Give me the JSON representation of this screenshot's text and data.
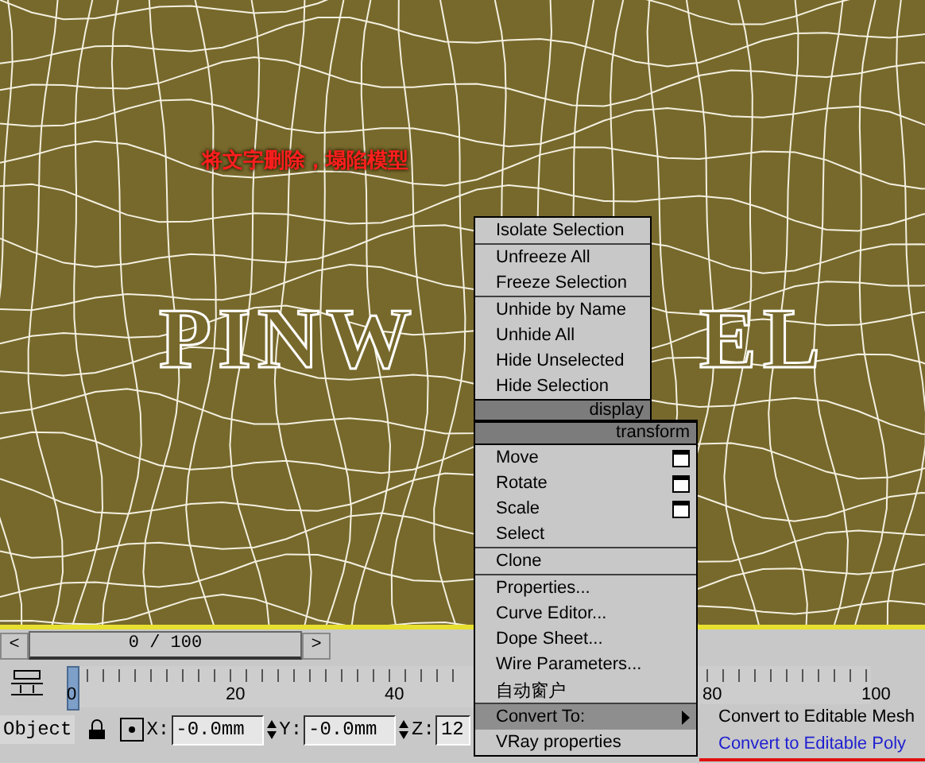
{
  "viewport": {
    "annotation": "将文字删除，塌陷模型",
    "text_object": [
      "PINW",
      "EL"
    ]
  },
  "quad_menu": {
    "display": {
      "title": "display",
      "groups": [
        [
          {
            "label": "Isolate Selection",
            "has_options": false,
            "selected": false
          }
        ],
        [
          {
            "label": "Unfreeze All",
            "has_options": false,
            "selected": false
          },
          {
            "label": "Freeze Selection",
            "has_options": false,
            "selected": false
          }
        ],
        [
          {
            "label": "Unhide by Name",
            "has_options": false,
            "selected": false
          },
          {
            "label": "Unhide All",
            "has_options": false,
            "selected": false
          },
          {
            "label": "Hide Unselected",
            "has_options": false,
            "selected": false
          },
          {
            "label": "Hide Selection",
            "has_options": false,
            "selected": false
          }
        ]
      ]
    },
    "transform": {
      "title": "transform",
      "groups": [
        [
          {
            "label": "Move",
            "has_options": true,
            "selected": false
          },
          {
            "label": "Rotate",
            "has_options": true,
            "selected": false
          },
          {
            "label": "Scale",
            "has_options": true,
            "selected": false
          },
          {
            "label": "Select",
            "has_options": false,
            "selected": false
          }
        ],
        [
          {
            "label": "Clone",
            "has_options": false,
            "selected": false
          }
        ],
        [
          {
            "label": "Properties...",
            "has_options": false,
            "selected": false
          },
          {
            "label": "Curve Editor...",
            "has_options": false,
            "selected": false
          },
          {
            "label": "Dope Sheet...",
            "has_options": false,
            "selected": false
          },
          {
            "label": "Wire Parameters...",
            "has_options": false,
            "selected": false
          },
          {
            "label": "自动窗户",
            "has_options": false,
            "selected": false
          }
        ],
        [
          {
            "label": "Convert To:",
            "has_options": false,
            "selected": true,
            "submenu": true
          },
          {
            "label": "VRay properties",
            "has_options": false,
            "selected": false
          }
        ]
      ]
    }
  },
  "submenu": {
    "items": [
      {
        "label": "Convert to Editable Mesh",
        "selected": false,
        "underlined": false
      },
      {
        "label": "Convert to Editable Poly",
        "selected": true,
        "underlined": true
      }
    ]
  },
  "timeline": {
    "prev": "<",
    "slider": {
      "label": "0 / 100",
      "level": 0
    },
    "next": ">",
    "ruler": {
      "level": 0
    },
    "ticks": [
      "0",
      "20",
      "40",
      "80",
      "100"
    ]
  },
  "coords": {
    "mode": "Object",
    "fields": [
      {
        "label": "X:",
        "value": "-0.0mm"
      },
      {
        "label": "Y:",
        "value": "-0.0mm"
      },
      {
        "label": "Z:",
        "value": "12"
      }
    ]
  }
}
